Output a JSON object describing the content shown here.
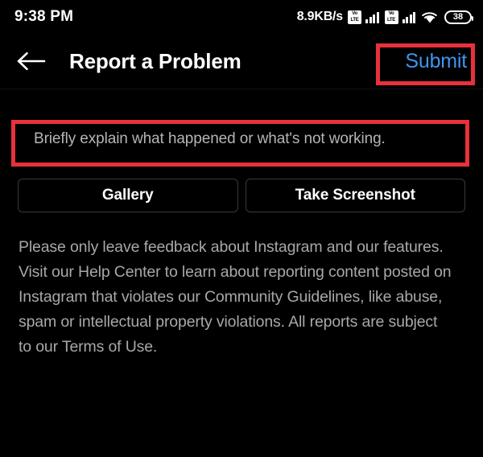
{
  "status_bar": {
    "time": "9:38 PM",
    "network_speed": "8.9KB/s",
    "sim1_label_top": "Vo",
    "sim1_label_bottom": "LTE",
    "sim2_label_top": "Vo",
    "sim2_label_bottom": "LTE",
    "battery_level": "38"
  },
  "header": {
    "title": "Report a Problem",
    "submit_label": "Submit",
    "submit_color": "#3e95ef"
  },
  "main": {
    "input_placeholder": "Briefly explain what happened or what's not working.",
    "input_value": "",
    "gallery_label": "Gallery",
    "screenshot_label": "Take Screenshot",
    "disclaimer": "Please only leave feedback about Instagram and our features. Visit our Help Center to learn about reporting content posted on Instagram that violates our Community Guidelines, like abuse, spam or intellectual property violations. All reports are subject to our Terms of Use."
  },
  "annotations": {
    "highlight_color": "#e8313a"
  }
}
